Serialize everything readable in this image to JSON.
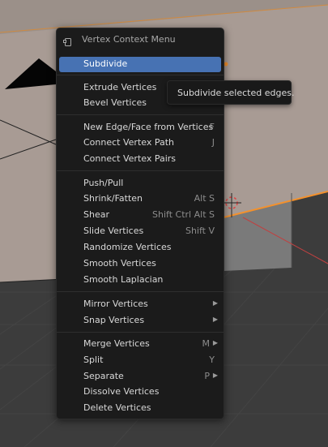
{
  "menu": {
    "title": "Vertex Context Menu",
    "icon": "context-menu-icon",
    "groups": [
      [
        {
          "label": "Subdivide",
          "shortcut": "",
          "submenu": false,
          "active": true
        }
      ],
      [
        {
          "label": "Extrude Vertices",
          "shortcut": "",
          "submenu": false
        },
        {
          "label": "Bevel Vertices",
          "shortcut": "",
          "submenu": false
        }
      ],
      [
        {
          "label": "New Edge/Face from Vertices",
          "shortcut": "F",
          "submenu": false
        },
        {
          "label": "Connect Vertex Path",
          "shortcut": "J",
          "submenu": false
        },
        {
          "label": "Connect Vertex Pairs",
          "shortcut": "",
          "submenu": false
        }
      ],
      [
        {
          "label": "Push/Pull",
          "shortcut": "",
          "submenu": false
        },
        {
          "label": "Shrink/Fatten",
          "shortcut": "Alt S",
          "submenu": false
        },
        {
          "label": "Shear",
          "shortcut": "Shift Ctrl Alt S",
          "submenu": false
        },
        {
          "label": "Slide Vertices",
          "shortcut": "Shift V",
          "submenu": false
        },
        {
          "label": "Randomize Vertices",
          "shortcut": "",
          "submenu": false
        },
        {
          "label": "Smooth Vertices",
          "shortcut": "",
          "submenu": false
        },
        {
          "label": "Smooth Laplacian",
          "shortcut": "",
          "submenu": false
        }
      ],
      [
        {
          "label": "Mirror Vertices",
          "shortcut": "",
          "submenu": true
        },
        {
          "label": "Snap Vertices",
          "shortcut": "",
          "submenu": true
        }
      ],
      [
        {
          "label": "Merge Vertices",
          "shortcut": "M",
          "submenu": true
        },
        {
          "label": "Split",
          "shortcut": "Y",
          "submenu": false
        },
        {
          "label": "Separate",
          "shortcut": "P",
          "submenu": true
        },
        {
          "label": "Dissolve Vertices",
          "shortcut": "",
          "submenu": false
        },
        {
          "label": "Delete Vertices",
          "shortcut": "",
          "submenu": false
        }
      ]
    ]
  },
  "tooltip": {
    "text": "Subdivide selected edges."
  },
  "colors": {
    "highlight": "#4772b3",
    "menu_bg": "#1b1b1b",
    "plane": "#a89b94",
    "edge_selected": "#f3912d"
  }
}
